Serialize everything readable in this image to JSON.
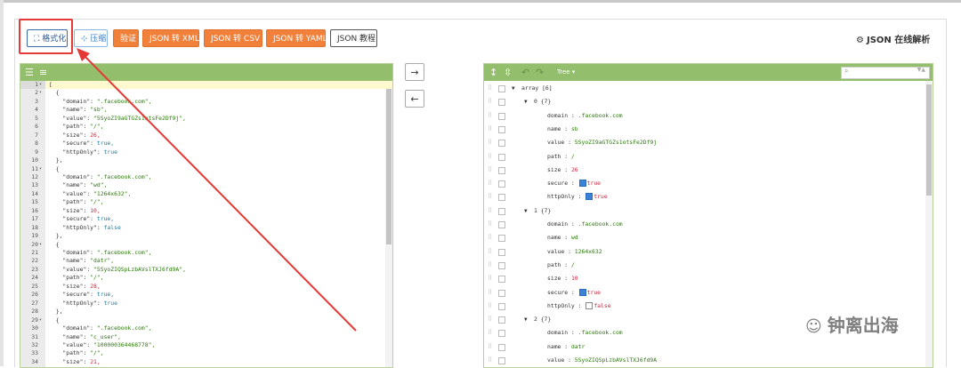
{
  "toolbar": {
    "format_label": "格式化",
    "format_icon": "expand-icon",
    "compress_label": "压缩",
    "compress_icon": "compress-icon",
    "verify_label": "验证",
    "xml_label": "JSON 转 XML",
    "csv_label": "JSON 转 CSV",
    "yaml_label": "JSON 转 YAML",
    "tutorial_label": "JSON 教程",
    "accent_orange": "#f0803a"
  },
  "site": {
    "title": "JSON 在线解析",
    "icon": "gears-icon"
  },
  "arrows": {
    "to_right": "→",
    "to_left": "←"
  },
  "right_panel": {
    "mode_label": "Tree ▾",
    "header_color": "#93bf6c"
  },
  "code_lines": [
    {
      "n": "1",
      "fold": "▾",
      "t": "["
    },
    {
      "n": "2",
      "fold": "▾",
      "t": "  {"
    },
    {
      "n": "3",
      "fold": "",
      "t": "    \"domain\": \".facebook.com\","
    },
    {
      "n": "4",
      "fold": "",
      "t": "    \"name\": \"sb\","
    },
    {
      "n": "5",
      "fold": "",
      "t": "    \"value\": \"5SyoZI9aGTGZs1otsFe2Df9j\","
    },
    {
      "n": "6",
      "fold": "",
      "t": "    \"path\": \"/\","
    },
    {
      "n": "7",
      "fold": "",
      "t": "    \"size\": 26,"
    },
    {
      "n": "8",
      "fold": "",
      "t": "    \"secure\": true,"
    },
    {
      "n": "9",
      "fold": "",
      "t": "    \"httpOnly\": true"
    },
    {
      "n": "10",
      "fold": "",
      "t": "  },"
    },
    {
      "n": "11",
      "fold": "▾",
      "t": "  {"
    },
    {
      "n": "12",
      "fold": "",
      "t": "    \"domain\": \".facebook.com\","
    },
    {
      "n": "13",
      "fold": "",
      "t": "    \"name\": \"wd\","
    },
    {
      "n": "14",
      "fold": "",
      "t": "    \"value\": \"1264x632\","
    },
    {
      "n": "15",
      "fold": "",
      "t": "    \"path\": \"/\","
    },
    {
      "n": "16",
      "fold": "",
      "t": "    \"size\": 10,"
    },
    {
      "n": "17",
      "fold": "",
      "t": "    \"secure\": true,"
    },
    {
      "n": "18",
      "fold": "",
      "t": "    \"httpOnly\": false"
    },
    {
      "n": "19",
      "fold": "",
      "t": "  },"
    },
    {
      "n": "20",
      "fold": "▾",
      "t": "  {"
    },
    {
      "n": "21",
      "fold": "",
      "t": "    \"domain\": \".facebook.com\","
    },
    {
      "n": "22",
      "fold": "",
      "t": "    \"name\": \"datr\","
    },
    {
      "n": "23",
      "fold": "",
      "t": "    \"value\": \"5SyoZIQSpLzbAVslTXJ6fd9A\","
    },
    {
      "n": "24",
      "fold": "",
      "t": "    \"path\": \"/\","
    },
    {
      "n": "25",
      "fold": "",
      "t": "    \"size\": 28,"
    },
    {
      "n": "26",
      "fold": "",
      "t": "    \"secure\": true,"
    },
    {
      "n": "27",
      "fold": "",
      "t": "    \"httpOnly\": true"
    },
    {
      "n": "28",
      "fold": "",
      "t": "  },"
    },
    {
      "n": "29",
      "fold": "▾",
      "t": "  {"
    },
    {
      "n": "30",
      "fold": "",
      "t": "    \"domain\": \".facebook.com\","
    },
    {
      "n": "31",
      "fold": "",
      "t": "    \"name\": \"c_user\","
    },
    {
      "n": "32",
      "fold": "",
      "t": "    \"value\": \"100000364468778\","
    },
    {
      "n": "33",
      "fold": "",
      "t": "    \"path\": \"/\","
    },
    {
      "n": "34",
      "fold": "",
      "t": "    \"size\": 21,"
    }
  ],
  "tree_rows": [
    {
      "level": 0,
      "tri": "▼",
      "label": "array [6]",
      "kind": "node"
    },
    {
      "level": 1,
      "tri": "▼",
      "label": "0 {7}",
      "kind": "node"
    },
    {
      "level": 2,
      "key": "domain",
      "val": ".facebook.com",
      "vt": "s"
    },
    {
      "level": 2,
      "key": "name",
      "val": "sb",
      "vt": "s"
    },
    {
      "level": 2,
      "key": "value",
      "val": "5SyoZI9aGTGZs1otsFe2Df9j",
      "vt": "s"
    },
    {
      "level": 2,
      "key": "path",
      "val": "/",
      "vt": "s"
    },
    {
      "level": 2,
      "key": "size",
      "val": "26",
      "vt": "n"
    },
    {
      "level": 2,
      "key": "secure",
      "val": "true",
      "vt": "b",
      "chk": true
    },
    {
      "level": 2,
      "key": "httpOnly",
      "val": "true",
      "vt": "b",
      "chk": true
    },
    {
      "level": 1,
      "tri": "▼",
      "label": "1 {7}",
      "kind": "node"
    },
    {
      "level": 2,
      "key": "domain",
      "val": ".facebook.com",
      "vt": "s"
    },
    {
      "level": 2,
      "key": "name",
      "val": "wd",
      "vt": "s"
    },
    {
      "level": 2,
      "key": "value",
      "val": "1264x632",
      "vt": "s"
    },
    {
      "level": 2,
      "key": "path",
      "val": "/",
      "vt": "s"
    },
    {
      "level": 2,
      "key": "size",
      "val": "10",
      "vt": "n"
    },
    {
      "level": 2,
      "key": "secure",
      "val": "true",
      "vt": "b",
      "chk": true
    },
    {
      "level": 2,
      "key": "httpOnly",
      "val": "false",
      "vt": "b",
      "chk": false
    },
    {
      "level": 1,
      "tri": "▼",
      "label": "2 {7}",
      "kind": "node"
    },
    {
      "level": 2,
      "key": "domain",
      "val": ".facebook.com",
      "vt": "s"
    },
    {
      "level": 2,
      "key": "name",
      "val": "datr",
      "vt": "s"
    },
    {
      "level": 2,
      "key": "value",
      "val": "5SyoZIQSpLzbAVslTXJ6fd9A",
      "vt": "s"
    }
  ],
  "watermark": {
    "text": "钟离出海",
    "icon": "wechat-icon"
  }
}
